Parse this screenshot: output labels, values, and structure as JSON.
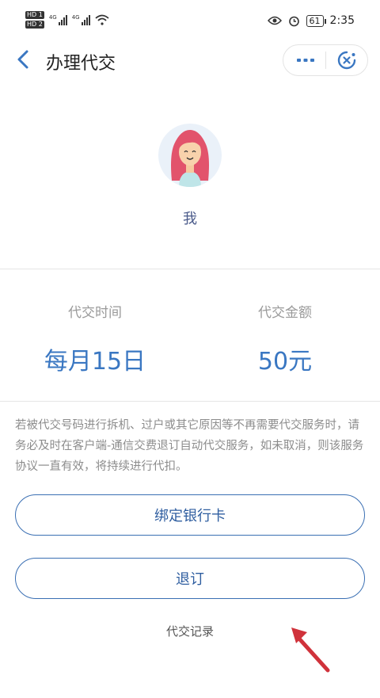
{
  "status_bar": {
    "hd1": "HD 1",
    "hd2": "HD 2",
    "net1": "4G",
    "net2": "4G",
    "battery": "61",
    "time": "2:35"
  },
  "navbar": {
    "back_icon": "chevron-left-icon",
    "title": "办理代交",
    "more_icon": "more-dots-icon",
    "close_icon": "close-circle-icon"
  },
  "profile": {
    "avatar_icon": "girl-avatar",
    "name": "我"
  },
  "info": {
    "time_label": "代交时间",
    "time_value": "每月15日",
    "amount_label": "代交金额",
    "amount_value": "50元"
  },
  "notice": "若被代交号码进行拆机、过户或其它原因等不再需要代交服务时，请务必及时在客户端-通信交费退订自动代交服务，如未取消，则该服务协议一直有效，将持续进行代扣。",
  "buttons": {
    "bind_card": "绑定银行卡",
    "unsubscribe": "退订"
  },
  "record_link": "代交记录",
  "colors": {
    "accent": "#3a77c2",
    "button_border": "#3a6fb3",
    "annotation_arrow": "#d0323b"
  }
}
